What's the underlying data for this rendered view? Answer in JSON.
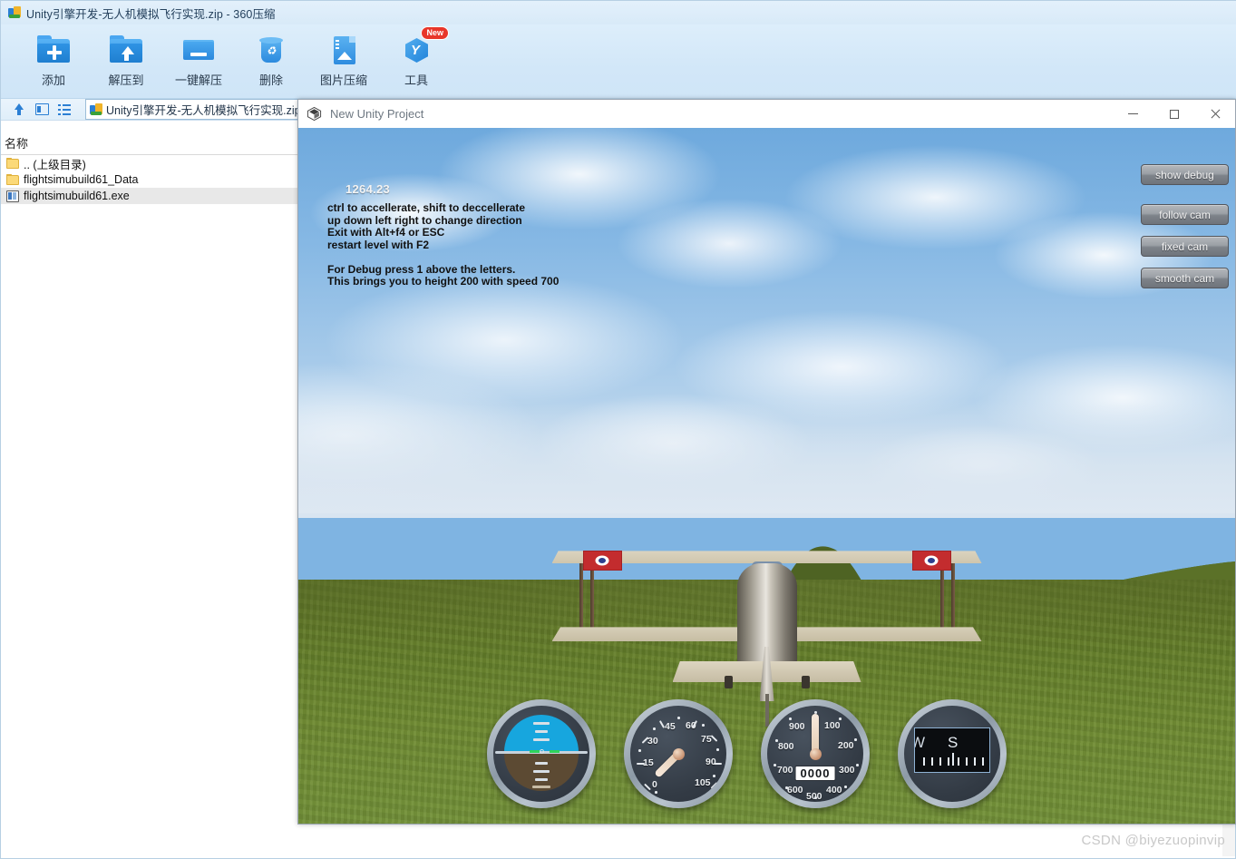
{
  "zip_app": {
    "title": "Unity引擎开发-无人机模拟飞行实现.zip - 360压缩",
    "app_icon": "zip-app-icon",
    "toolbar": [
      {
        "label": "添加",
        "icon": "folder-plus-icon",
        "badge": ""
      },
      {
        "label": "解压到",
        "icon": "folder-extract-icon",
        "badge": ""
      },
      {
        "label": "一键解压",
        "icon": "one-click-extract-icon",
        "badge": ""
      },
      {
        "label": "删除",
        "icon": "recycle-bin-icon",
        "badge": ""
      },
      {
        "label": "图片压缩",
        "icon": "image-compress-icon",
        "badge": ""
      },
      {
        "label": "工具",
        "icon": "tools-cube-icon",
        "badge": "New"
      }
    ],
    "pathbar": {
      "up_icon": "up-arrow-icon",
      "view_icon": "view-pane-icon",
      "list_icon": "list-view-icon",
      "path_value": "Unity引擎开发-无人机模拟飞行实现.zip\\",
      "path_caret": "‹"
    },
    "column_header": "名称",
    "files": [
      {
        "name": ".. (上级目录)",
        "icon": "folder-icon",
        "selected": false
      },
      {
        "name": "flightsimubuild61_Data",
        "icon": "folder-icon",
        "selected": false
      },
      {
        "name": "flightsimubuild61.exe",
        "icon": "exe-icon",
        "selected": true
      }
    ]
  },
  "unity_window": {
    "title": "New Unity Project",
    "logo_icon": "unity-logo-icon",
    "controls": {
      "minimize": "minimize-icon",
      "maximize": "maximize-icon",
      "close": "close-icon"
    }
  },
  "game": {
    "hud": {
      "speed_value": "1264.23",
      "help_text": "ctrl to accellerate, shift to deccellerate\nup down left right to change direction\nExit with Alt+f4 or ESC\nrestart level with F2\n\nFor Debug press 1 above the letters.\nThis brings you to height 200 with speed 700"
    },
    "buttons": [
      {
        "label": "show debug",
        "name": "show-debug-button"
      },
      {
        "label": "follow cam",
        "name": "follow-cam-button"
      },
      {
        "label": "fixed cam",
        "name": "fixed-cam-button"
      },
      {
        "label": "smooth cam",
        "name": "smooth-cam-button"
      }
    ],
    "instruments": {
      "attitude": {
        "name": "artificial-horizon-gauge"
      },
      "airspeed": {
        "name": "airspeed-gauge",
        "labels": [
          "0",
          "15",
          "30",
          "45",
          "60",
          "75",
          "90",
          "105"
        ],
        "needle_value": "0"
      },
      "altimeter": {
        "name": "altimeter-gauge",
        "labels": [
          "100",
          "200",
          "300",
          "400",
          "500",
          "600",
          "700",
          "800",
          "900"
        ],
        "readout": "0000"
      },
      "compass": {
        "name": "compass-gauge",
        "heading_letter": "S",
        "prev_letter": "W"
      }
    },
    "colors": {
      "sky": "#7fb4e2",
      "ground": "#66802c",
      "hill": "#4e6323",
      "roundel_red": "#c32c2e",
      "button_face": "#8d9299"
    }
  },
  "watermark": "CSDN @biyezuopinvip"
}
